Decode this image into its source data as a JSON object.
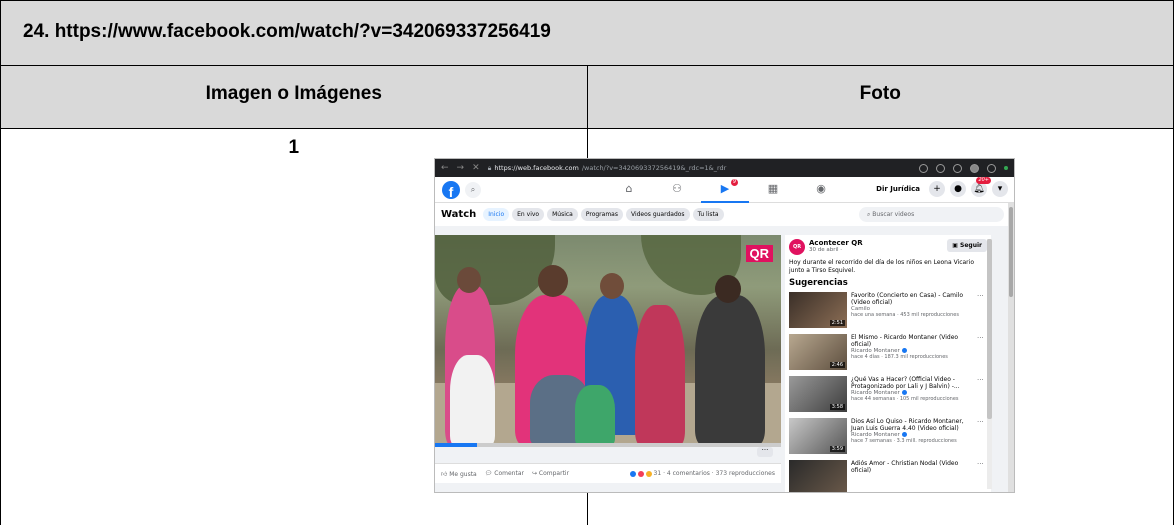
{
  "doc": {
    "url_title": "24. https://www.facebook.com/watch/?v=342069337256419",
    "col_header_1": "Imagen o Imágenes",
    "col_header_2": "Foto",
    "row_number": "1"
  },
  "browser": {
    "url_host": "https://web.facebook.com",
    "url_path": "/watch/?v=342069337256419&_rdc=1&_rdr"
  },
  "fb": {
    "user_name": "Dir Jurídica",
    "video_badge": "9",
    "notif_badge": "20+",
    "watch_title": "Watch",
    "tabs": [
      "Inicio",
      "En vivo",
      "Música",
      "Programas",
      "Videos guardados",
      "Tu lista"
    ],
    "search_placeholder": "Buscar videos",
    "video_logo": "QR",
    "actions": {
      "like": "Me gusta",
      "comment": "Comentar",
      "share": "Compartir",
      "stats": "31 · 4 comentarios · 373 reproducciones"
    },
    "post": {
      "page_name": "Acontecer QR",
      "date": "30 de abril ·",
      "follow": "Seguir",
      "text": "Hoy durante el recorrido del día de los niños en Leona Vicario junto a Tirso Esquivel."
    },
    "suggestions_title": "Sugerencias",
    "suggestions": [
      {
        "title": "Favorito (Concierto en Casa) - Camilo (Video oficial)",
        "channel": "Camilo",
        "meta": "hace una semana · 453 mil reproducciones",
        "duration": "2:51"
      },
      {
        "title": "El Mismo - Ricardo Montaner (Video oficial)",
        "channel": "Ricardo Montaner",
        "meta": "hace 4 días · 187.3 mil reproducciones",
        "duration": "2:46"
      },
      {
        "title": "¿Qué Vas a Hacer? (Official Video - Protagonizado por Lali y J Balvin) -...",
        "channel": "Ricardo Montaner",
        "meta": "hace 44 semanas · 105 mil reproducciones",
        "duration": "3:58"
      },
      {
        "title": "Dios Así Lo Quiso - Ricardo Montaner, Juan Luis Guerra 4.40 (Video oficial)",
        "channel": "Ricardo Montaner",
        "meta": "hace 7 semanas · 3.3 mill. reproducciones",
        "duration": "3:59"
      },
      {
        "title": "Adiós Amor - Christian Nodal (Video oficial)",
        "channel": "",
        "meta": "",
        "duration": ""
      }
    ]
  },
  "colors": {
    "header_gray": "#d9d9d9",
    "fb_blue": "#1877f2",
    "qr_pink": "#e0115f"
  }
}
